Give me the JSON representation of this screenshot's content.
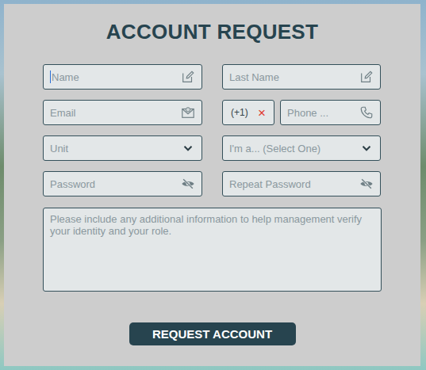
{
  "title": "ACCOUNT REQUEST",
  "fields": [
    {
      "kind": "text",
      "placeholder": "Name",
      "focused": true
    },
    {
      "kind": "text",
      "placeholder": "Last Name",
      "focused": false
    },
    {
      "kind": "email",
      "placeholder": "Email",
      "focused": false
    },
    {
      "kind": "phone",
      "code": "(+1)",
      "clear": "×",
      "placeholder": "Phone ...",
      "focused": false
    },
    {
      "kind": "select",
      "placeholder": "Unit",
      "focused": false
    },
    {
      "kind": "select",
      "placeholder": "I'm a... (Select One)",
      "focused": false
    },
    {
      "kind": "password",
      "placeholder": "Password",
      "focused": false
    },
    {
      "kind": "password",
      "placeholder": "Repeat Password",
      "focused": false
    }
  ],
  "notes": {
    "placeholder": "Please include any additional information to help management verify your identity and your role."
  },
  "button": "REQUEST ACCOUNT"
}
